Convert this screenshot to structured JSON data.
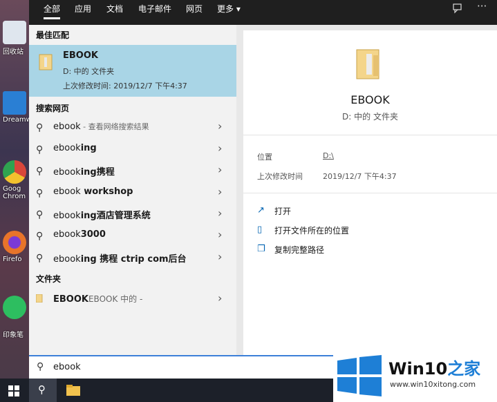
{
  "desktop": {
    "icons": [
      {
        "label": "回收站",
        "icon": "recycle-bin-icon",
        "color": "#dfe6ee"
      },
      {
        "label": "Dreamw",
        "icon": "dreamweaver-icon",
        "color": "#2a7fd4"
      },
      {
        "label": "Goog Chrom",
        "icon": "chrome-icon",
        "color": "#d9463a"
      },
      {
        "label": "Firefo",
        "icon": "firefox-icon",
        "color": "#e8742a"
      },
      {
        "label": "印象笔",
        "icon": "evernote-icon",
        "color": "#2dbe60"
      }
    ]
  },
  "tabs": [
    "全部",
    "应用",
    "文档",
    "电子邮件",
    "网页",
    "更多 ▾"
  ],
  "topbar_icons": {
    "feedback": "feedback-icon",
    "more": "···"
  },
  "left": {
    "best_match_header": "最佳匹配",
    "best": {
      "name": "EBOOK",
      "location": "D: 中的 文件夹",
      "modified": "上次修改时间: 2019/12/7 下午4:37"
    },
    "web_header": "搜索网页",
    "web_results": [
      {
        "bold": "ebook",
        "rest": "",
        "hint": " - 查看网络搜索结果"
      },
      {
        "bold": "ebook",
        "rest": "ing",
        "hint": ""
      },
      {
        "bold": "ebook",
        "rest": "ing携程",
        "hint": ""
      },
      {
        "bold": "ebook",
        "rest": " workshop",
        "hint": ""
      },
      {
        "bold": "ebook",
        "rest": "ing酒店管理系统",
        "hint": ""
      },
      {
        "bold": "ebook",
        "rest": "3000",
        "hint": ""
      },
      {
        "bold": "ebook",
        "rest": "ing 携程 ctrip com后台",
        "hint": ""
      }
    ],
    "folder_header": "文件夹",
    "folder_result": {
      "bold": "EBOOK",
      "rest": "EBOOK 中的 -"
    }
  },
  "right": {
    "title": "EBOOK",
    "subtitle": "D: 中的 文件夹",
    "location_label": "位置",
    "location_value": "D:\\",
    "modified_label": "上次修改时间",
    "modified_value": "2019/12/7 下午4:37",
    "actions": [
      {
        "label": "打开",
        "icon": "open-icon"
      },
      {
        "label": "打开文件所在的位置",
        "icon": "open-folder-location-icon"
      },
      {
        "label": "复制完整路径",
        "icon": "copy-path-icon"
      }
    ]
  },
  "search": {
    "value": "ebook"
  },
  "watermark": {
    "brand": "Win10",
    "suffix": "之家",
    "url": "www.win10xitong.com"
  },
  "colors": {
    "highlight": "#a9d5e6",
    "accent": "#3b7fd8",
    "taskbar": "#1c2029"
  }
}
